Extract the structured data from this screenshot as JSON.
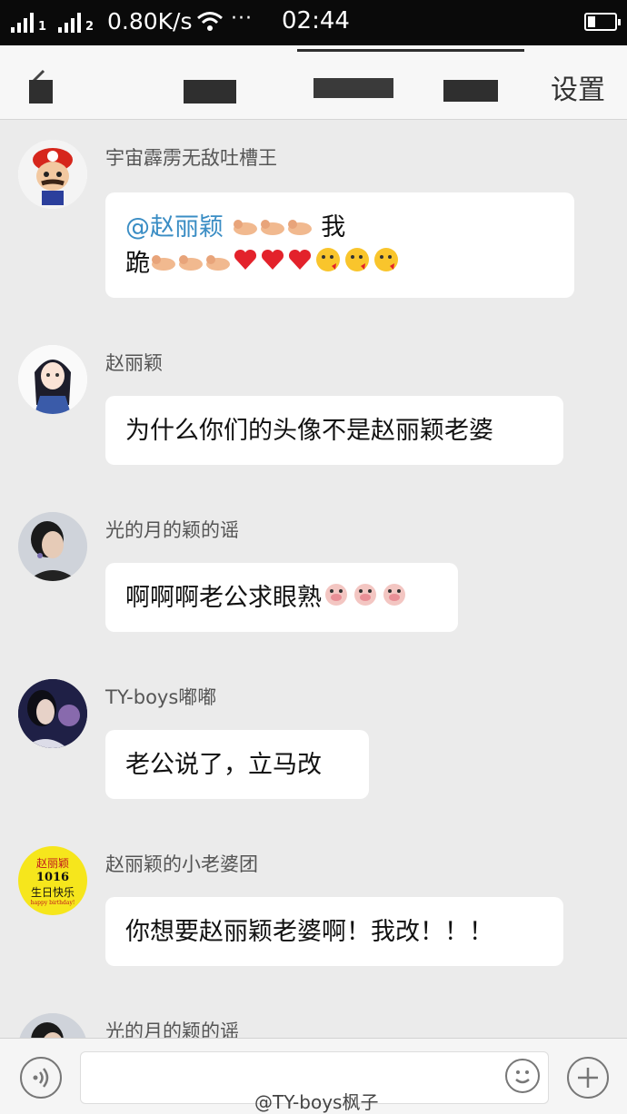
{
  "status_bar": {
    "sim1": "1",
    "sim2": "2",
    "net_speed": "0.80K/s",
    "more": "···",
    "time": "02:44"
  },
  "header": {
    "settings_label": "设置"
  },
  "messages": [
    {
      "sender": "宇宙霹雳无敌吐槽王",
      "mention": "@赵丽颖",
      "line1_tail": "我",
      "line2_text": "跪"
    },
    {
      "sender": "赵丽颖",
      "text": "为什么你们的头像不是赵丽颖老婆"
    },
    {
      "sender": "光的月的颖的谣",
      "text": "啊啊啊老公求眼熟"
    },
    {
      "sender": "TY-boys嘟嘟",
      "text": "老公说了，立马改"
    },
    {
      "sender": "赵丽颖的小老婆团",
      "text": "你想要赵丽颖老婆啊！我改！！！"
    },
    {
      "sender": "光的月的颖的谣"
    }
  ],
  "avatar_text": {
    "line1": "赵丽颖",
    "line2": "1016",
    "line3": "生日快乐",
    "line4": "happy birthday!"
  },
  "watermark": "@TY-boys枫子",
  "colors": {
    "mention": "#3a8dc4",
    "status_bar": "#0a0a0a",
    "background": "#ebebeb"
  }
}
